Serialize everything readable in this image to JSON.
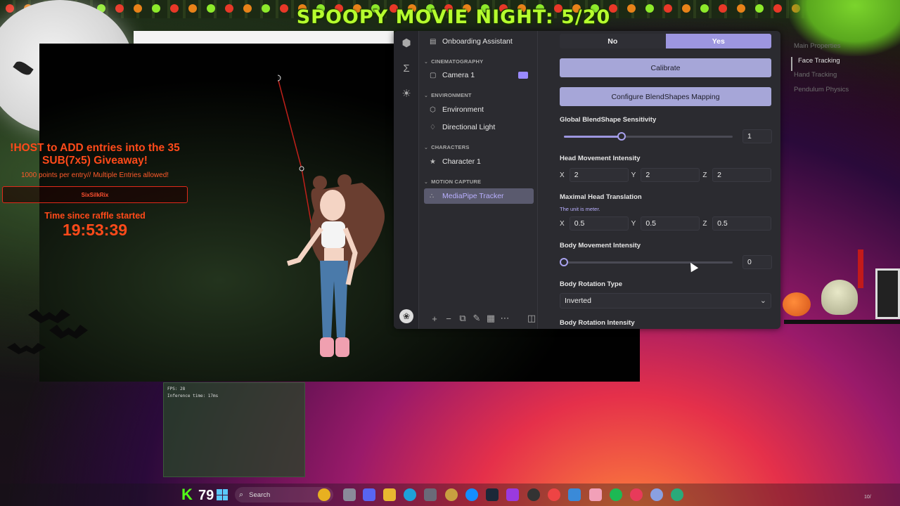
{
  "banner": {
    "title": "SPOOPY MOVIE NIGHT: 5/20"
  },
  "giveaway": {
    "title": "!HOST to ADD entries into the 35 SUB(7x5) Giveaway!",
    "subtitle": "1000 points per entry// Multiple Entries allowed!",
    "entrant": "SixSilkRix",
    "timer_label": "Time since raffle started",
    "timer_value": "19:53:39"
  },
  "app": {
    "tree": {
      "onboarding": "Onboarding Assistant",
      "categories": [
        {
          "label": "CINEMATOGRAPHY",
          "items": [
            {
              "label": "Camera 1",
              "icon": "camera-icon"
            }
          ]
        },
        {
          "label": "ENVIRONMENT",
          "items": [
            {
              "label": "Environment",
              "icon": "environment-icon"
            },
            {
              "label": "Directional Light",
              "icon": "lightbulb-icon"
            }
          ]
        },
        {
          "label": "CHARACTERS",
          "items": [
            {
              "label": "Character 1",
              "icon": "character-icon"
            }
          ]
        },
        {
          "label": "MOTION CAPTURE",
          "items": [
            {
              "label": "MediaPipe Tracker",
              "icon": "tracker-icon",
              "selected": true
            }
          ]
        }
      ]
    },
    "panel": {
      "toggle_no": "No",
      "toggle_yes": "Yes",
      "calibrate": "Calibrate",
      "configure": "Configure BlendShapes Mapping",
      "sensitivity": {
        "label": "Global BlendShape Sensitivity",
        "value": "1",
        "fraction": 0.34
      },
      "head_movement": {
        "label": "Head Movement Intensity",
        "x": "2",
        "y": "2",
        "z": "2"
      },
      "head_translation": {
        "label": "Maximal Head Translation",
        "note": "The unit is meter.",
        "x": "0.5",
        "y": "0.5",
        "z": "0.5"
      },
      "body_movement": {
        "label": "Body Movement Intensity",
        "value": "0",
        "fraction": 0.0
      },
      "body_rotation_type": {
        "label": "Body Rotation Type",
        "value": "Inverted"
      },
      "body_rotation_intensity": {
        "label": "Body Rotation Intensity"
      },
      "axis_x": "X",
      "axis_y": "Y",
      "axis_z": "Z"
    },
    "right_nav": [
      {
        "label": "Main Properties",
        "active": false
      },
      {
        "label": "Face Tracking",
        "active": true
      },
      {
        "label": "Hand Tracking",
        "active": false
      },
      {
        "label": "Pendulum Physics",
        "active": false
      }
    ]
  },
  "debug": {
    "fps": "FPS: 28",
    "inference": "Inference time: 17ms"
  },
  "taskbar": {
    "kick_count": "79",
    "search_placeholder": "Search",
    "clock": "10/"
  },
  "colors": {
    "accent": "#9d96e0",
    "banner": "#b6ff2e",
    "giveaway": "#ff4a1a",
    "kick": "#53fc18"
  }
}
